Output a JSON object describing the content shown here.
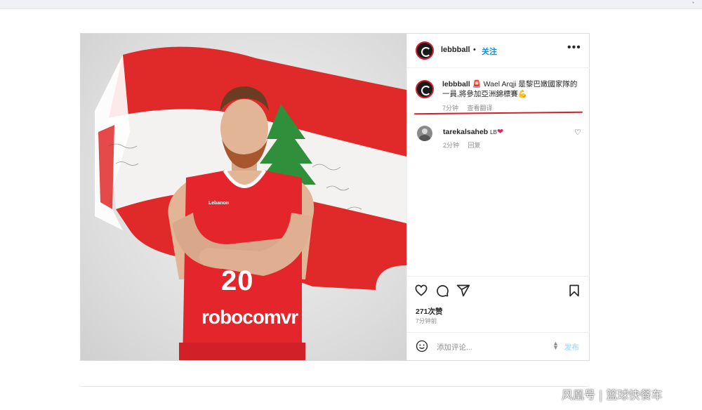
{
  "colors": {
    "link_blue": "#0095f6",
    "publish_disabled": "#b2dffc",
    "annotation_red": "#d81e2b",
    "flag_red": "#e02a2a",
    "cedar_green": "#2f8f3a",
    "jersey_red": "#e4262c"
  },
  "post": {
    "header": {
      "username": "lebbball",
      "separator": "•",
      "follow_label": "关注",
      "more_icon": "more-horizontal-icon"
    },
    "caption": {
      "username": "lebbball",
      "emoji": "🚨",
      "text": "Wael Arqji 是黎巴嫩國家隊的一員,將參加亞洲錦標賽💪",
      "time": "7分钟",
      "see_translation": "查看翻译"
    },
    "comments": [
      {
        "username": "tarekalsaheb",
        "text": "LB",
        "emoji": "❤",
        "time": "2分钟",
        "reply_label": "回复"
      }
    ],
    "photo": {
      "jersey_number": "20",
      "jersey_sponsor": "robocomvr",
      "jersey_small_text": "Lebanon"
    },
    "likes": "271次赞",
    "timestamp": "7分钟前",
    "composer": {
      "placeholder": "添加评论...",
      "publish_label": "发布"
    }
  },
  "watermark": "风凰号 | 篮球快餐车"
}
